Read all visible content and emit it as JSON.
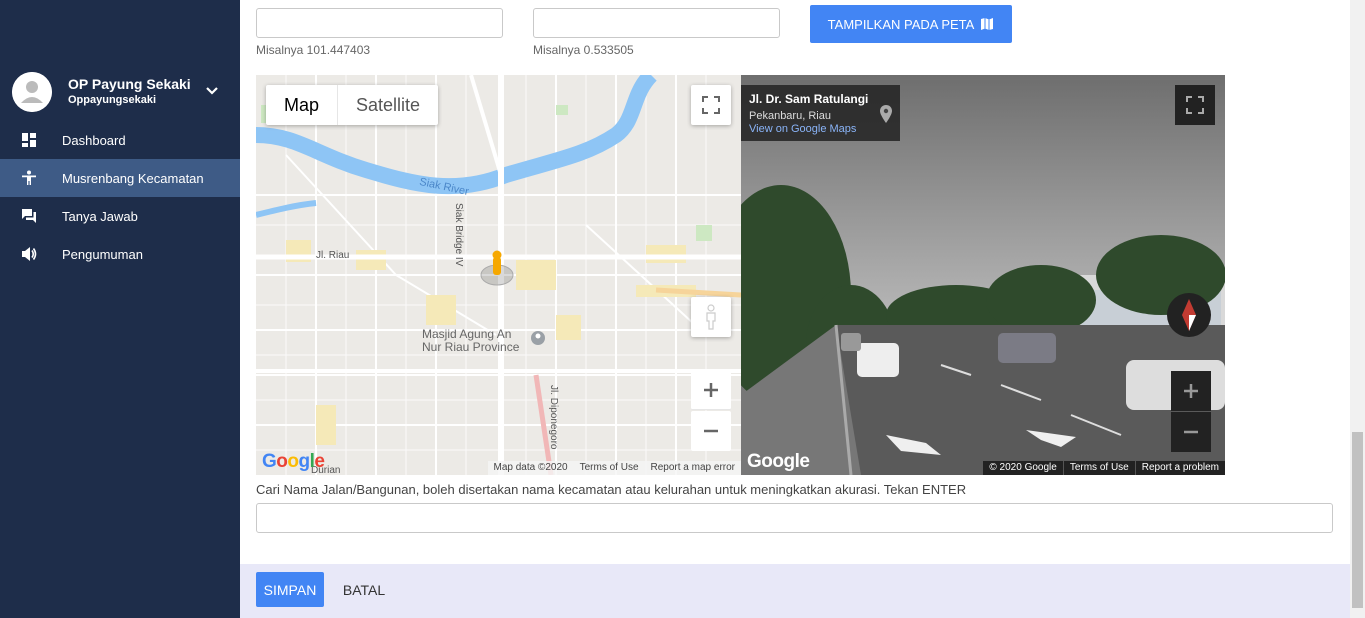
{
  "sidebar": {
    "profile": {
      "name": "OP Payung Sekaki",
      "username": "Oppayungsekaki"
    },
    "items": [
      {
        "label": "Dashboard",
        "icon": "dashboard-icon",
        "active": false
      },
      {
        "label": "Musrenbang Kecamatan",
        "icon": "person-icon",
        "active": true
      },
      {
        "label": "Tanya Jawab",
        "icon": "chat-icon",
        "active": false
      },
      {
        "label": "Pengumuman",
        "icon": "megaphone-icon",
        "active": false
      }
    ]
  },
  "form": {
    "longitude": {
      "value": "",
      "hint": "Misalnya 101.447403"
    },
    "latitude": {
      "value": "",
      "hint": "Misalnya 0.533505"
    },
    "show_on_map_label": "TAMPILKAN PADA PETA",
    "search_label": "Cari Nama Jalan/Bangunan, boleh disertakan nama kecamatan atau kelurahan untuk meningkatkan akurasi. Tekan ENTER",
    "search_value": ""
  },
  "map": {
    "tabs": [
      "Map",
      "Satellite"
    ],
    "active_tab": "Map",
    "labels": {
      "river": "Siak River",
      "bridge": "Siak Bridge IV",
      "road_riau": "Jl. Riau",
      "mosque": "Masjid Agung An Nur Riau Province",
      "diponegoro": "Jl. Diponegoro",
      "durian": "Durian"
    },
    "footer": [
      "Map data ©2020",
      "Terms of Use",
      "Report a map error"
    ],
    "logo": "Google"
  },
  "streetview": {
    "title": "Jl. Dr. Sam Ratulangi",
    "subtitle": "Pekanbaru, Riau",
    "link": "View on Google Maps",
    "footer": [
      "© 2020 Google",
      "Terms of Use",
      "Report a problem"
    ],
    "logo": "Google"
  },
  "actions": {
    "save": "SIMPAN",
    "cancel": "BATAL"
  },
  "colors": {
    "sidebar": "#1e2d4a",
    "sidebar_active": "#3e5b86",
    "primary": "#4285f4",
    "footer": "#e8e8f8"
  }
}
